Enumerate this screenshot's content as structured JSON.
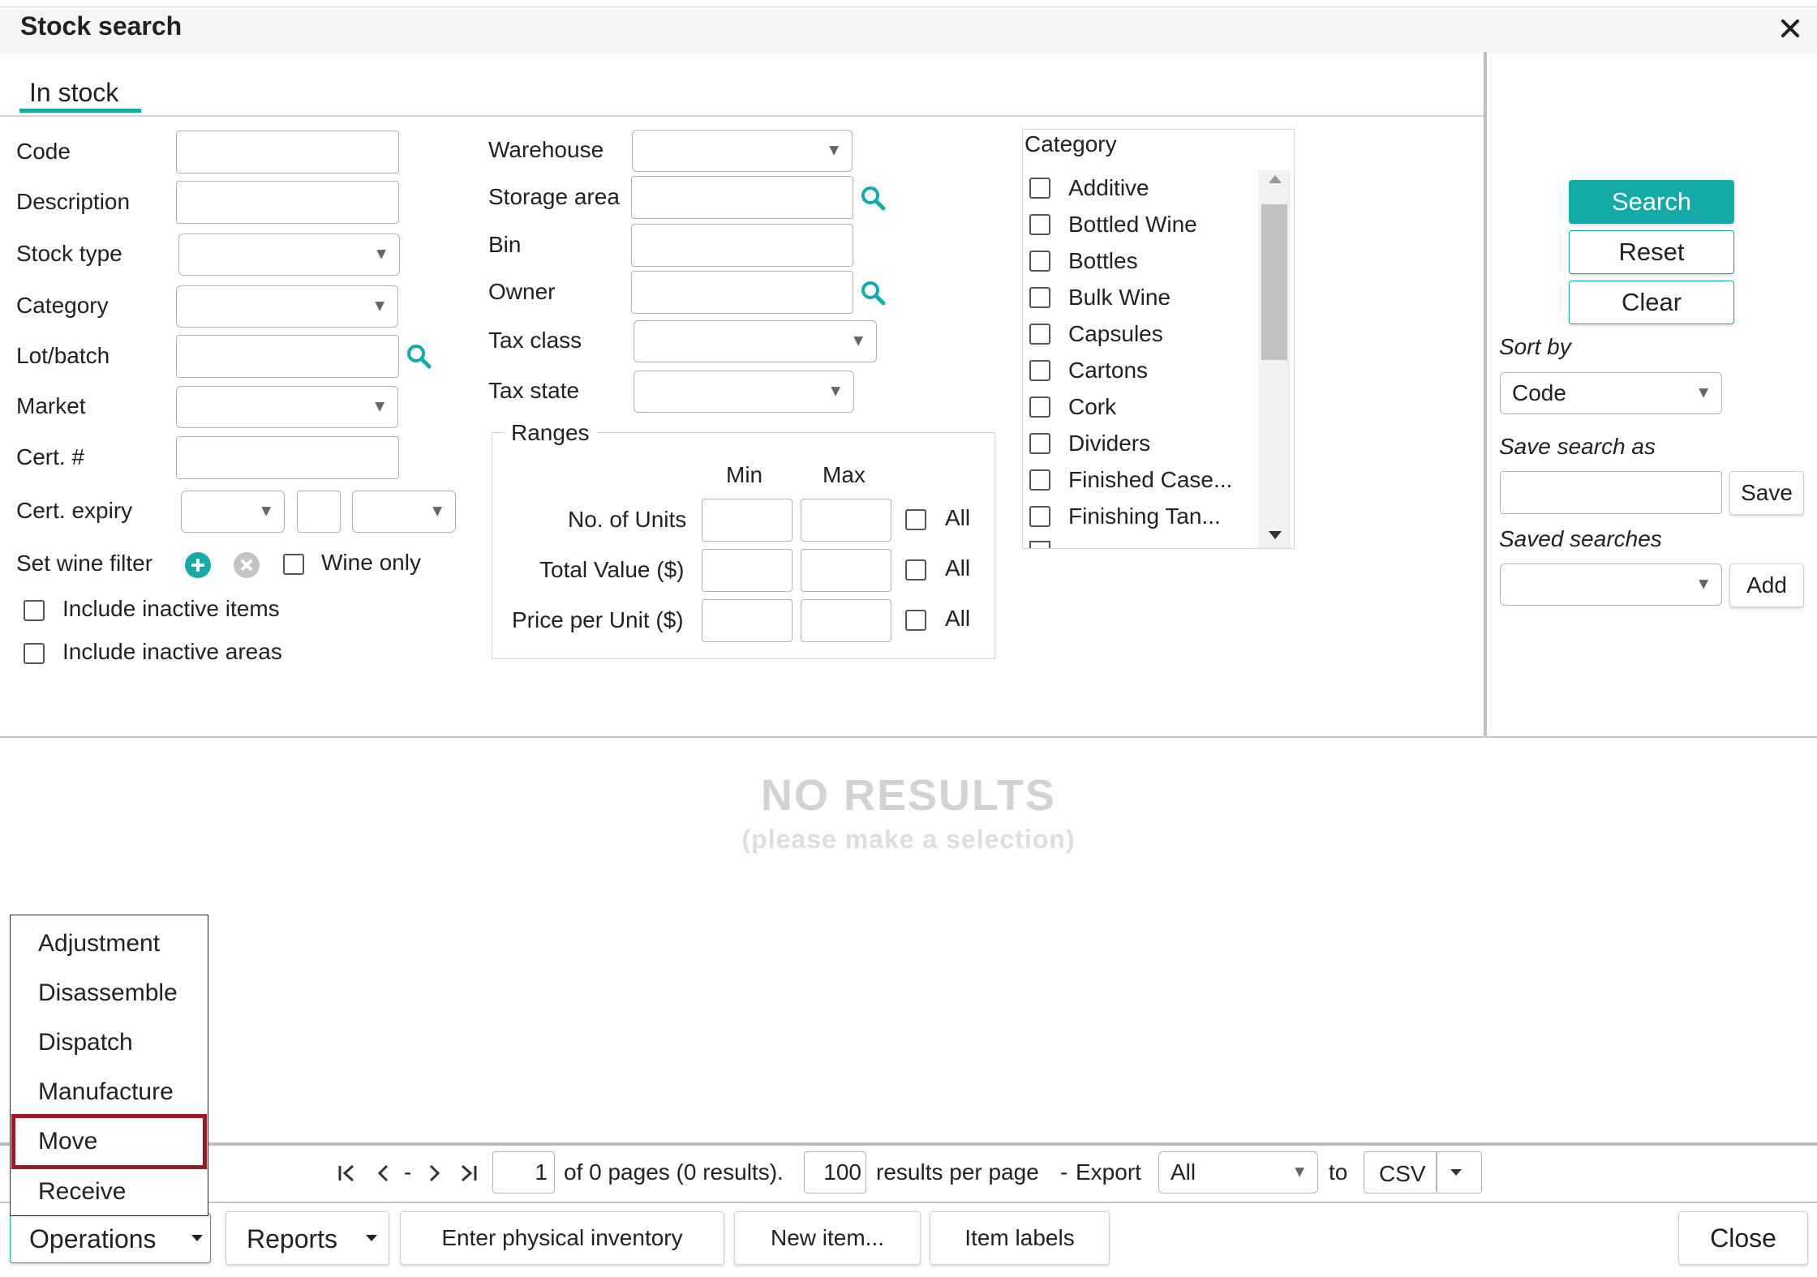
{
  "window": {
    "title": "Stock search"
  },
  "tabs": [
    {
      "label": "In stock"
    }
  ],
  "fields": {
    "code": "Code",
    "description": "Description",
    "stock_type": "Stock type",
    "category": "Category",
    "lot_batch": "Lot/batch",
    "market": "Market",
    "cert_no": "Cert. #",
    "cert_expiry": "Cert. expiry",
    "set_wine_filter": "Set wine filter",
    "wine_only": "Wine only",
    "include_inactive_items": "Include inactive items",
    "include_inactive_areas": "Include inactive areas",
    "warehouse": "Warehouse",
    "storage_area": "Storage area",
    "bin": "Bin",
    "owner": "Owner",
    "tax_class": "Tax class",
    "tax_state": "Tax state"
  },
  "ranges": {
    "title": "Ranges",
    "min": "Min",
    "max": "Max",
    "rows": [
      {
        "label": "No. of Units",
        "all": "All"
      },
      {
        "label": "Total Value ($)",
        "all": "All"
      },
      {
        "label": "Price per Unit ($)",
        "all": "All"
      }
    ]
  },
  "category_list": {
    "title": "Category",
    "items": [
      "Additive",
      "Bottled Wine",
      "Bottles",
      "Bulk Wine",
      "Capsules",
      "Cartons",
      "Cork",
      "Dividers",
      "Finished Case...",
      "Finishing Tan..."
    ]
  },
  "actions": {
    "search": "Search",
    "reset": "Reset",
    "clear": "Clear",
    "sort_by": "Sort by",
    "sort_value": "Code",
    "save_search_as": "Save search as",
    "save": "Save",
    "saved_searches": "Saved searches",
    "add": "Add"
  },
  "results": {
    "empty_title": "NO RESULTS",
    "empty_sub": "(please make a selection)"
  },
  "pagination": {
    "page": "1",
    "of_pages": "of 0 pages (0 results).",
    "per_page": "100",
    "per_page_label": "results per page",
    "dash": "-",
    "export_label": "Export",
    "export_value": "All",
    "to": "to",
    "format": "CSV"
  },
  "operations_menu": {
    "items": [
      "Adjustment",
      "Disassemble",
      "Dispatch",
      "Manufacture",
      "Move",
      "Receive"
    ],
    "highlighted": "Move"
  },
  "toolbar": {
    "operations": "Operations",
    "reports": "Reports",
    "enter_physical_inventory": "Enter physical inventory",
    "new_item": "New item...",
    "item_labels": "Item labels",
    "close": "Close"
  },
  "colors": {
    "accent": "#14aaa8",
    "highlight_border": "#9b1b25"
  }
}
